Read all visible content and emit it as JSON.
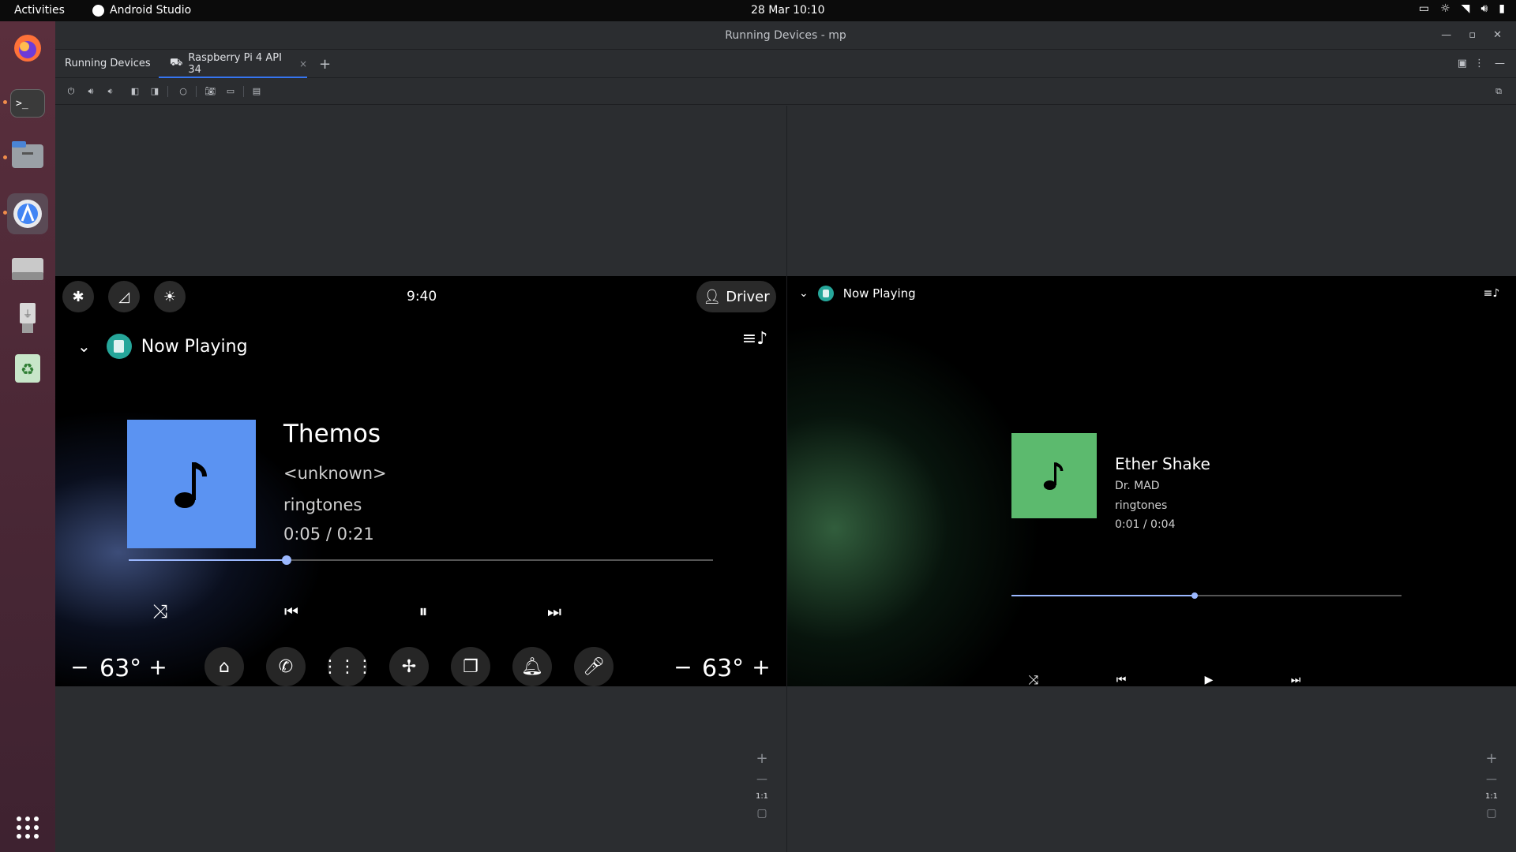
{
  "topbar": {
    "activities": "Activities",
    "app_name": "Android Studio",
    "datetime": "28 Mar  10:10"
  },
  "window": {
    "title": "Running Devices - mp"
  },
  "tabs": {
    "tool_title": "Running Devices",
    "device_tab": "Raspberry Pi 4 API 34",
    "add": "+"
  },
  "left_device": {
    "status_time": "9:40",
    "driver_label": "Driver",
    "header_title": "Now Playing",
    "track": {
      "title": "Themos",
      "artist": "<unknown>",
      "album": "ringtones",
      "time": "0:05 / 0:21",
      "progress": 0.27
    },
    "temp_left": "63°",
    "temp_right": "63°",
    "minus": "−",
    "plus": "+"
  },
  "right_device": {
    "header_title": "Now Playing",
    "track": {
      "title": "Ether Shake",
      "artist": "Dr. MAD",
      "album": "ringtones",
      "time": "0:01 / 0:04",
      "progress": 0.47
    }
  },
  "zoom": {
    "plus": "+",
    "minus": "—",
    "one_to_one": "1:1"
  },
  "colors": {
    "album_left": "#5b93f2",
    "album_right": "#5cba6e",
    "accent_tab": "#3574f0"
  }
}
